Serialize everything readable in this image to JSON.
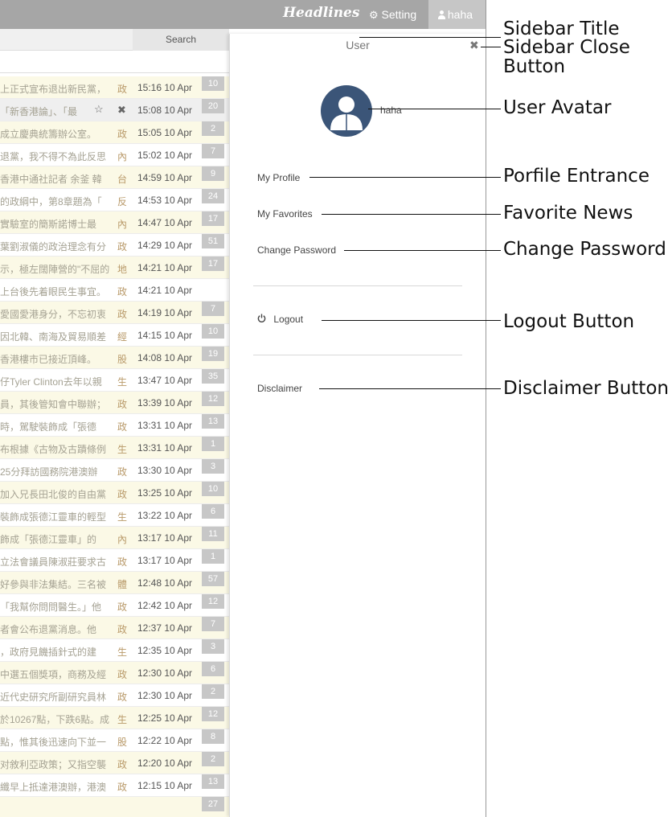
{
  "topbar": {
    "brand": "Headlines",
    "setting_label": "Setting",
    "user_label": "haha"
  },
  "search": {
    "button_label": "Search"
  },
  "news_rows": [
    {
      "title": "上正式宣布退出新民黨，",
      "category": "政",
      "time": "15:16 10 Apr",
      "count": "10"
    },
    {
      "title": "「新香港論」、「最",
      "category": "",
      "time": "15:08 10 Apr",
      "count": "20"
    },
    {
      "title": "成立慶典統籌辦公室。",
      "category": "政",
      "time": "15:05 10 Apr",
      "count": "2"
    },
    {
      "title": "退黨，我不得不為此反思",
      "category": "內",
      "time": "15:02 10 Apr",
      "count": "7"
    },
    {
      "title": "香港中通社記者 余釜 韓",
      "category": "台",
      "time": "14:59 10 Apr",
      "count": "9"
    },
    {
      "title": "的政綱中，第8章題為「",
      "category": "反",
      "time": "14:53 10 Apr",
      "count": "24"
    },
    {
      "title": "實驗室的簡斯諾博士最",
      "category": "內",
      "time": "14:47 10 Apr",
      "count": "17"
    },
    {
      "title": "葉劉淑儀的政治理念有分",
      "category": "政",
      "time": "14:29 10 Apr",
      "count": "51"
    },
    {
      "title": "示，極左闊陣營的\"不屈的",
      "category": "地",
      "time": "14:21 10 Apr",
      "count": "17"
    },
    {
      "title": "上台後先着眼民生事宜。",
      "category": "政",
      "time": "14:21 10 Apr",
      "count": ""
    },
    {
      "title": "愛國愛港身分，不忘初衷",
      "category": "政",
      "time": "14:19 10 Apr",
      "count": "7"
    },
    {
      "title": "因北韓、南海及貿易順差",
      "category": "經",
      "time": "14:15 10 Apr",
      "count": "10"
    },
    {
      "title": "香港樓市已接近頂峰。",
      "category": "股",
      "time": "14:08 10 Apr",
      "count": "19"
    },
    {
      "title": "仔Tyler Clinton去年以親",
      "category": "生",
      "time": "13:47 10 Apr",
      "count": "35"
    },
    {
      "title": "員，其後管知會中聯辦；",
      "category": "政",
      "time": "13:39 10 Apr",
      "count": "12"
    },
    {
      "title": "時，駕駛裝飾成「張德",
      "category": "政",
      "time": "13:31 10 Apr",
      "count": "13"
    },
    {
      "title": "布根據《古物及古蹟條例",
      "category": "生",
      "time": "13:31 10 Apr",
      "count": "1"
    },
    {
      "title": "25分拜訪國務院港澳辦",
      "category": "政",
      "time": "13:30 10 Apr",
      "count": "3"
    },
    {
      "title": "加入兄長田北俊的自由黨",
      "category": "政",
      "time": "13:25 10 Apr",
      "count": "10"
    },
    {
      "title": "裝飾成張德江靈車的輕型",
      "category": "生",
      "time": "13:22 10 Apr",
      "count": "6"
    },
    {
      "title": "飾成「張德江靈車」的",
      "category": "內",
      "time": "13:17 10 Apr",
      "count": "11"
    },
    {
      "title": "立法會議員陳淑莊要求古",
      "category": "政",
      "time": "13:17 10 Apr",
      "count": "1"
    },
    {
      "title": "好參與非法集結。三名被",
      "category": "體",
      "time": "12:48 10 Apr",
      "count": "57"
    },
    {
      "title": "「我幫你問問醫生。」他",
      "category": "政",
      "time": "12:42 10 Apr",
      "count": "12"
    },
    {
      "title": "者會公布退黨消息。他",
      "category": "政",
      "time": "12:37 10 Apr",
      "count": "7"
    },
    {
      "title": "，政府見饑插針式的建",
      "category": "生",
      "time": "12:35 10 Apr",
      "count": "3"
    },
    {
      "title": "中選五個獎項，商務及經",
      "category": "政",
      "time": "12:30 10 Apr",
      "count": "6"
    },
    {
      "title": "近代史研究所副研究員林",
      "category": "政",
      "time": "12:30 10 Apr",
      "count": "2"
    },
    {
      "title": "於10267點，下跌6點。成",
      "category": "生",
      "time": "12:25 10 Apr",
      "count": "12"
    },
    {
      "title": "點，惟其後迅速向下並一",
      "category": "股",
      "time": "12:22 10 Apr",
      "count": "8"
    },
    {
      "title": "对敘利亞政策；又指空襲",
      "category": "政",
      "time": "12:20 10 Apr",
      "count": "2"
    },
    {
      "title": "纖早上抵達港澳辦，港澳",
      "category": "政",
      "time": "12:15 10 Apr",
      "count": "13"
    },
    {
      "title": "",
      "category": "",
      "time": "",
      "count": "27"
    }
  ],
  "sidebar": {
    "title": "User",
    "close_glyph": "✖",
    "username": "haha",
    "my_profile": "My Profile",
    "my_favorites": "My Favorites",
    "change_password": "Change Password",
    "logout": "Logout",
    "disclaimer": "Disclaimer"
  },
  "annotations": {
    "sidebar_title": "Sidebar Title",
    "sidebar_close_button_line1": "Sidebar Close",
    "sidebar_close_button_line2": "Button",
    "user_avatar": "User Avatar",
    "profile_entrance": "Porfile Entrance",
    "favorite_news": "Favorite News",
    "change_password": "Change Password",
    "logout_button": "Logout Button",
    "disclaimer_button": "Disclaimer Button"
  },
  "icons": {
    "setting": "gear-icon",
    "user": "user-icon",
    "star": "star-outline-icon",
    "remove": "close-icon",
    "logout": "power-icon"
  }
}
